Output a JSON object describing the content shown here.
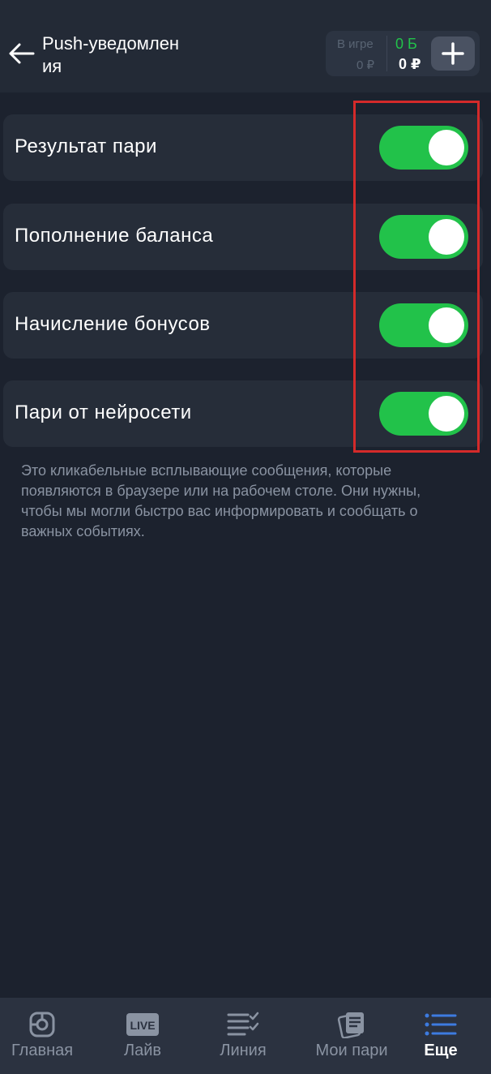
{
  "header": {
    "title": "Push-уведомления",
    "balance": {
      "in_game_label": "В игре",
      "in_game_value": "0 ₽",
      "bonus_value": "0 Б",
      "main_value": "0 ₽"
    }
  },
  "settings": [
    {
      "label": "Результат пари",
      "enabled": true
    },
    {
      "label": "Пополнение баланса",
      "enabled": true
    },
    {
      "label": "Начисление бонусов",
      "enabled": true
    },
    {
      "label": "Пари от нейросети",
      "enabled": true
    }
  ],
  "description": "Это кликабельные всплывающие сообщения, которые появляются в браузере или на рабочем столе. Они нужны, чтобы мы могли быстро вас информировать и сообщать о важных событиях.",
  "nav": {
    "items": [
      {
        "label": "Главная",
        "icon": "home-icon"
      },
      {
        "label": "Лайв",
        "icon": "live-icon",
        "badge": "LIVE"
      },
      {
        "label": "Линия",
        "icon": "line-list-icon"
      },
      {
        "label": "Мои пари",
        "icon": "my-bets-icon"
      },
      {
        "label": "Еще",
        "icon": "more-menu-icon",
        "active": true
      }
    ]
  },
  "colors": {
    "background": "#1c222e",
    "toggle_on": "#22c24a",
    "highlight": "#d42a2a",
    "active_nav": "#3d7be0"
  }
}
